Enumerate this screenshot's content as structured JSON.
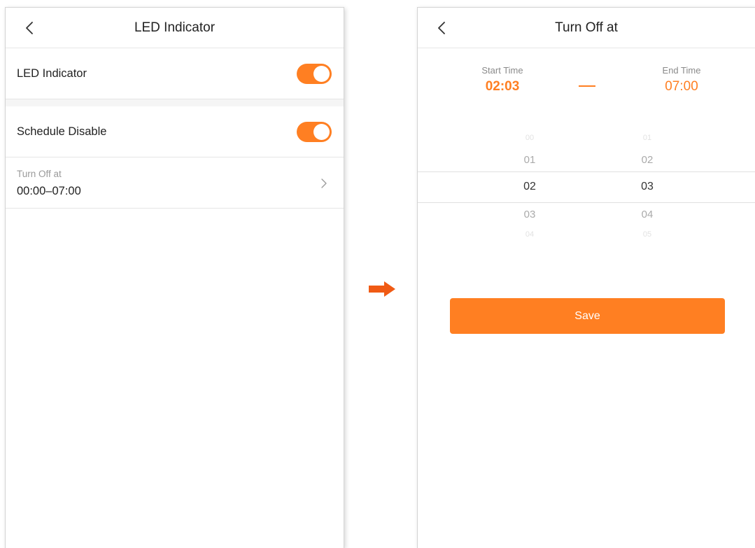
{
  "left_screen": {
    "header": {
      "title": "LED Indicator",
      "back_icon": "chevron-left-icon"
    },
    "led_indicator": {
      "label": "LED Indicator",
      "enabled": true
    },
    "schedule_disable": {
      "label": "Schedule Disable",
      "enabled": true
    },
    "turn_off_at": {
      "label": "Turn Off at",
      "value": "00:00–07:00",
      "icon": "chevron-right-icon"
    }
  },
  "transition_arrow": {
    "icon": "arrow-right-icon",
    "color": "#f05a14"
  },
  "right_screen": {
    "header": {
      "title": "Turn Off at",
      "back_icon": "chevron-left-icon"
    },
    "start_time": {
      "label": "Start Time",
      "value": "02:03"
    },
    "end_time": {
      "label": "End Time",
      "value": "07:00"
    },
    "picker": {
      "hours": [
        "00",
        "01",
        "02",
        "03",
        "04"
      ],
      "minutes": [
        "01",
        "02",
        "03",
        "04",
        "05"
      ],
      "selected_hour": "02",
      "selected_minute": "03"
    },
    "save_label": "Save"
  },
  "colors": {
    "accent": "#ff7f22",
    "divider": "#e6e6e6",
    "muted_text": "#9a9a9a"
  }
}
